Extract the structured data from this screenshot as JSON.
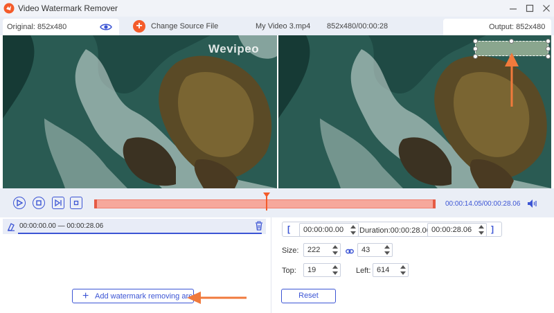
{
  "app": {
    "title": "Video Watermark Remover"
  },
  "infobar": {
    "original_label": "Original: 852x480",
    "change_source_label": "Change Source File",
    "filename": "My Video 3.mp4",
    "file_info": "852x480/00:00:28",
    "output_label": "Output: 852x480"
  },
  "preview": {
    "watermark_text": "Wevipeo"
  },
  "controls": {
    "timecode": "00:00:14.05/00:00:28.06",
    "playhead_fraction": 0.5
  },
  "segment": {
    "time_range": "00:00:00.00 — 00:00:28.06"
  },
  "add_area": {
    "label": "Add watermark removing area"
  },
  "right": {
    "start_time": "00:00:00.00",
    "duration_label": "Duration:00:00:28.06",
    "end_time": "00:00:28.06",
    "size_label": "Size:",
    "width": "222",
    "height": "43",
    "top_label": "Top:",
    "top": "19",
    "left_label": "Left:",
    "left": "614",
    "reset_label": "Reset"
  },
  "colors": {
    "accent": "#3b54d4",
    "orange": "#f45b2a",
    "timeline": "#f6a89c"
  }
}
